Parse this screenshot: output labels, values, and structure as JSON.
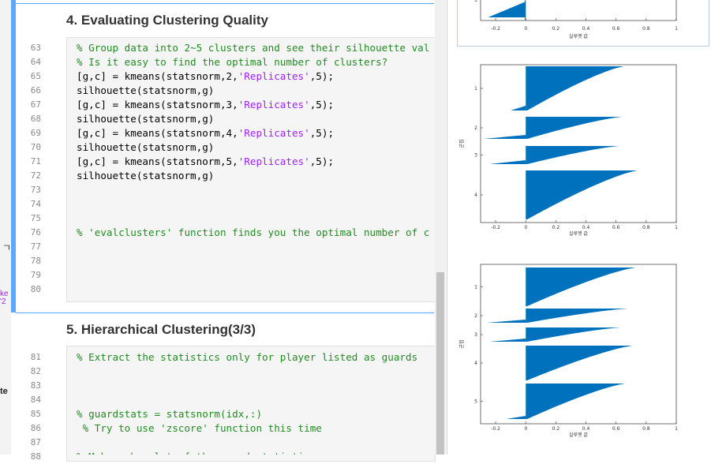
{
  "editor": {
    "section4_title": "4. Evaluating Clustering Quality",
    "section5_title": "5. Hierarchical Clustering(3/3)",
    "side_fragment_1": "ㄱ",
    "side_fragment_2": "ke\n'2",
    "side_fragment_3": "te",
    "lines4": [
      {
        "n": "63",
        "t": "% Group data into 2~5 clusters and see their silhouette val"
      },
      {
        "n": "64",
        "t": "% Is it easy to find the optimal number of clusters?"
      },
      {
        "n": "65",
        "t": "[g,c] = kmeans(statsnorm,2,'Replicates',5);"
      },
      {
        "n": "66",
        "t": "silhouette(statsnorm,g)"
      },
      {
        "n": "67",
        "t": "[g,c] = kmeans(statsnorm,3,'Replicates',5);"
      },
      {
        "n": "68",
        "t": "silhouette(statsnorm,g)"
      },
      {
        "n": "69",
        "t": "[g,c] = kmeans(statsnorm,4,'Replicates',5);"
      },
      {
        "n": "70",
        "t": "silhouette(statsnorm,g)"
      },
      {
        "n": "71",
        "t": "[g,c] = kmeans(statsnorm,5,'Replicates',5);"
      },
      {
        "n": "72",
        "t": "silhouette(statsnorm,g)"
      },
      {
        "n": "73",
        "t": ""
      },
      {
        "n": "74",
        "t": ""
      },
      {
        "n": "75",
        "t": ""
      },
      {
        "n": "76",
        "t": "% 'evalclusters' function finds you the optimal number of c"
      },
      {
        "n": "77",
        "t": ""
      },
      {
        "n": "78",
        "t": ""
      },
      {
        "n": "79",
        "t": ""
      },
      {
        "n": "80",
        "t": ""
      }
    ],
    "lines5": [
      {
        "n": "81",
        "t": "% Extract the statistics only for player listed as guards"
      },
      {
        "n": "82",
        "t": ""
      },
      {
        "n": "83",
        "t": ""
      },
      {
        "n": "84",
        "t": ""
      },
      {
        "n": "85",
        "t": "% guardstats = statsnorm(idx,:)"
      },
      {
        "n": "86",
        "t": " % Try to use 'zscore' function this time"
      },
      {
        "n": "87",
        "t": ""
      },
      {
        "n": "88",
        "t": "% Make a boxplot of the guard statistics"
      }
    ]
  },
  "plots": {
    "xlabel": "실루엣 값",
    "ylabel": "군집",
    "accent_color": "#0072bd",
    "top": {
      "xticks": [
        "-0.2",
        "0",
        "0.2",
        "0.4",
        "0.6",
        "0.8",
        "1"
      ],
      "visible_ytick": "3"
    },
    "mid": {
      "xticks": [
        "-0.2",
        "0",
        "0.2",
        "0.4",
        "0.6",
        "0.8",
        "1"
      ],
      "yticks": [
        "1",
        "2",
        "3",
        "4"
      ]
    },
    "bot": {
      "xticks": [
        "-0.2",
        "0",
        "0.2",
        "0.4",
        "0.6",
        "0.8",
        "1"
      ],
      "yticks": [
        "1",
        "2",
        "3",
        "4",
        "5"
      ]
    }
  }
}
